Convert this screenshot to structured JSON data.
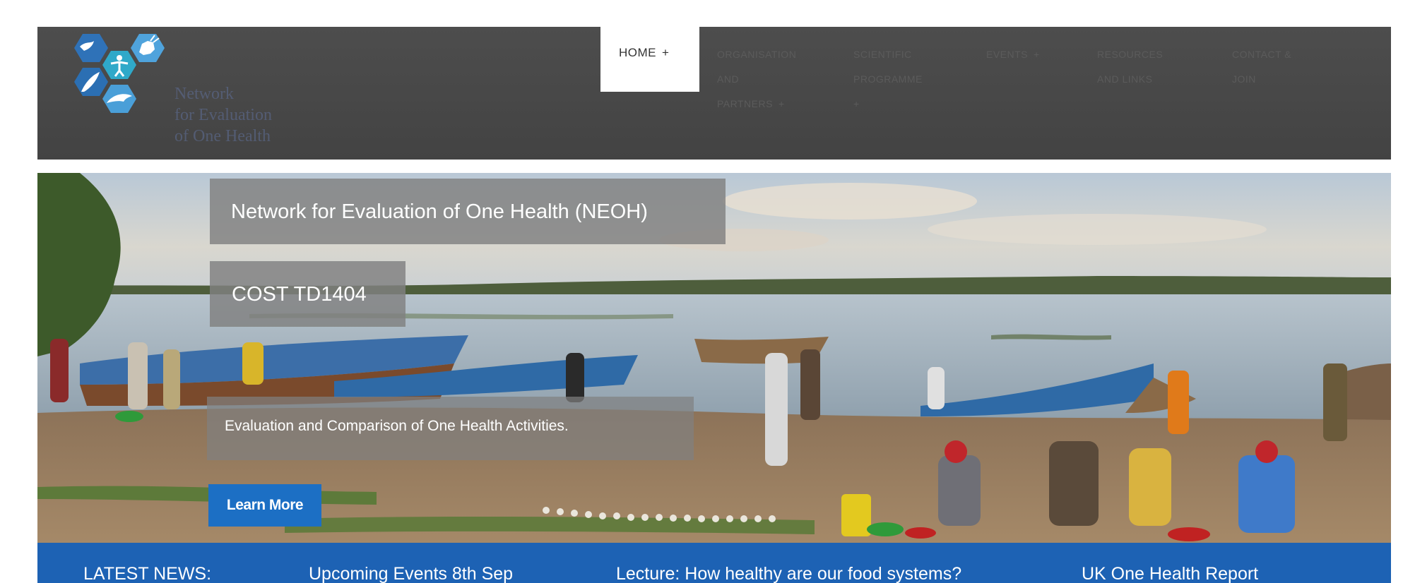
{
  "header": {
    "logo": {
      "text_lines": [
        "Network",
        "for Evaluation",
        "of One Health"
      ],
      "icons": [
        "bird-icon",
        "goat-icon",
        "person-icon",
        "feather-icon",
        "dolphin-icon"
      ],
      "colors": {
        "hex_dark": "#2b6fb3",
        "hex_light": "#4a9fd8"
      }
    },
    "nav": {
      "home": {
        "label": "HOME",
        "plus": "+"
      },
      "organisation": {
        "lines": [
          "ORGANISATION",
          "AND",
          "PARTNERS"
        ],
        "plus": "+"
      },
      "programme": {
        "lines": [
          "SCIENTIFIC",
          "PROGRAMME"
        ],
        "plus": "+"
      },
      "events": {
        "label": "EVENTS",
        "plus": "+"
      },
      "resources": {
        "lines": [
          "RESOURCES",
          "AND LINKS"
        ]
      },
      "contact": {
        "lines": [
          "CONTACT &",
          "JOIN"
        ]
      }
    }
  },
  "hero": {
    "title": "Network for Evaluation of One Health (NEOH)",
    "code": "COST TD1404",
    "tagline": "Evaluation and Comparison of One Health Activities.",
    "button_label": "Learn More"
  },
  "news": {
    "label": "LATEST NEWS:",
    "items": [
      "Upcoming Events 8th Sep",
      "Lecture: How healthy are our food systems?",
      "UK One Health Report"
    ]
  },
  "colors": {
    "header_bg": "#474747",
    "accent_blue": "#1d62b4",
    "button_blue": "#1c6fc4",
    "caption_gray": "#808080"
  }
}
